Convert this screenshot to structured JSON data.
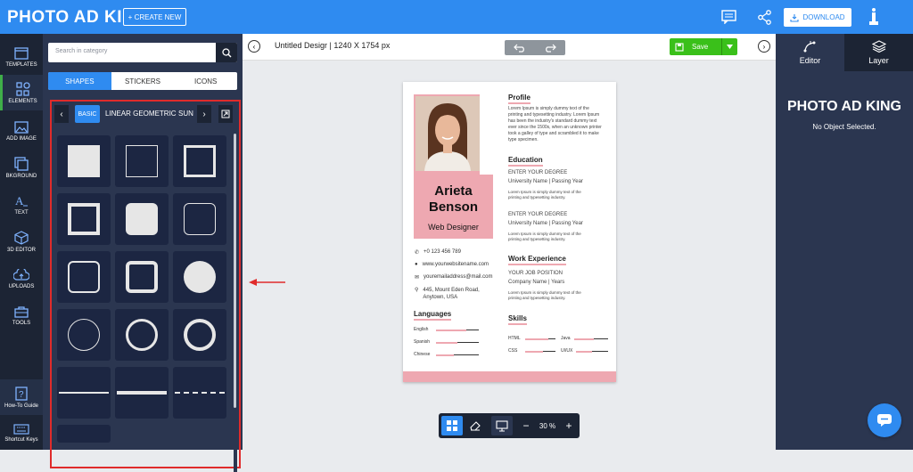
{
  "header": {
    "logo": "PHOTO AD KING",
    "create_label": "CREATE NEW",
    "download_label": "DOWNLOAD"
  },
  "leftnav": {
    "items": [
      {
        "label": "TEMPLATES",
        "icon": "templates-icon"
      },
      {
        "label": "ELEMENTS",
        "icon": "elements-icon"
      },
      {
        "label": "ADD IMAGE",
        "icon": "image-icon"
      },
      {
        "label": "BKGROUND",
        "icon": "background-icon"
      },
      {
        "label": "TEXT",
        "icon": "text-icon"
      },
      {
        "label": "3D EDITOR",
        "icon": "cube-icon"
      },
      {
        "label": "UPLOADS",
        "icon": "upload-icon"
      },
      {
        "label": "TOOLS",
        "icon": "tools-icon"
      }
    ],
    "bottom": [
      {
        "label": "How-To Guide",
        "icon": "help-icon"
      },
      {
        "label": "Shortcut Keys",
        "icon": "keyboard-icon"
      }
    ]
  },
  "panel": {
    "search_placeholder": "Search in category",
    "tabs": [
      "SHAPES",
      "STICKERS",
      "ICONS"
    ],
    "categories": [
      "BASIC",
      "LINEAR GEOMETRIC",
      "SUN"
    ]
  },
  "canvas": {
    "doc_title": "Untitled Desigr  |  1240 X 1754 px",
    "save_label": "Save",
    "zoom": "30 %"
  },
  "resume": {
    "first_name": "Arieta",
    "last_name": "Benson",
    "job": "Web Designer",
    "phone": "+0 123 456 789",
    "website": "www.yourwebsitename.com",
    "email": "youremailaddress@mail.com",
    "address1": "445, Mount Eden Road,",
    "address2": "Anytown, USA",
    "languages_title": "Languages",
    "languages": [
      "English",
      "Spanish",
      "Chinese"
    ],
    "profile_title": "Profile",
    "profile_text": "Lorem Ipsum is simply dummy text of the printing and typesetting industry. Lorem Ipsum has been the industry's standard dummy text ever since the 1500s, when an unknown printer took a galley of type and scrambled it to make type specimen.",
    "education_title": "Education",
    "degree1": "ENTER YOUR DEGREE",
    "univ1": "University Name | Passing Year",
    "edu_text1": "Lorem Ipsum is simply dummy text of the printing and typesetting industry.",
    "degree2": "ENTER YOUR DEGREE",
    "univ2": "University Name | Passing Year",
    "edu_text2": "Lorem Ipsum is simply dummy text of the printing and typesetting industry.",
    "work_title": "Work Experience",
    "position": "YOUR JOB POSITION",
    "company": "Company Name | Years",
    "work_text": "Lorem Ipsum is simply dummy text of the printing and typesetting industry.",
    "skills_title": "Skills",
    "skills": [
      "HTML",
      "Java",
      "CSS",
      "UI/UX"
    ]
  },
  "rightpanel": {
    "tab_editor": "Editor",
    "tab_layer": "Layer",
    "logo": "PHOTO AD KING",
    "message": "No Object Selected."
  }
}
